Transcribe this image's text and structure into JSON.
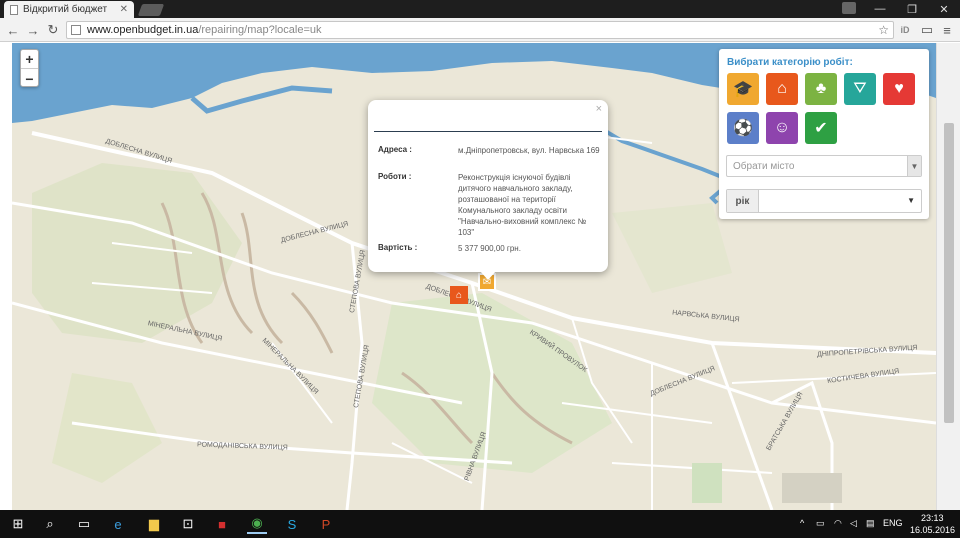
{
  "browser": {
    "tab_title": "Відкритий бюджет",
    "url_host": "www.openbudget.in.ua",
    "url_path": "/repairing/map?locale=uk"
  },
  "map": {
    "zoom_in": "+",
    "zoom_out": "−",
    "streets": [
      "ДОБЛЕСНА ВУЛИЦЯ",
      "ДОБЛЕСНА ВУЛИЦЯ",
      "ДОБЛЕСНА ВУЛИЦЯ",
      "ДОБЛЕСНА ВУЛИЦЯ",
      "МІНЕРАЛЬНА ВУЛИЦЯ",
      "МІНЕРАЛЬНА ВУЛИЦЯ",
      "СТЕПОВА ВУЛИЦЯ",
      "СТЕПОВА ВУЛИЦЯ",
      "РОМОДАНІВСЬКА ВУЛИЦЯ",
      "РІВНА ВУЛИЦЯ",
      "КРИВИЙ ПРОВУЛОК",
      "НАРВСЬКА ВУЛИЦЯ",
      "ДНІПРОПЕТРІВСЬКА ВУЛИЦЯ",
      "БРАТСЬКА ВУЛИЦЯ",
      "КОСТИЧЕВА ВУЛИЦЯ"
    ]
  },
  "popup": {
    "close": "×",
    "address_label": "Адреса :",
    "address_value": "м.Дніпропетровськ, вул. Нарвська 169",
    "works_label": "Роботи :",
    "works_value": "Реконструкція існуючої будівлі дитячого навчального закладу, розташованої на території Комунального закладу освіти \"Навчально-виховний комплекс № 103\"",
    "cost_label": "Вартість :",
    "cost_value": "5 377 900,00 грн."
  },
  "panel": {
    "title": "Вибрати категорію робіт:",
    "city_placeholder": "Обрати місто",
    "year_label": "рік",
    "categories": [
      {
        "icon": "education-cap-icon",
        "color": "#f0a830"
      },
      {
        "icon": "kindergarten-icon",
        "color": "#e8581c"
      },
      {
        "icon": "park-tree-icon",
        "color": "#7cb342"
      },
      {
        "icon": "road-icon",
        "color": "#26a69a"
      },
      {
        "icon": "heart-health-icon",
        "color": "#e53935"
      },
      {
        "icon": "sport-ball-icon",
        "color": "#5c7fc9"
      },
      {
        "icon": "culture-masks-icon",
        "color": "#8e44ad"
      },
      {
        "icon": "safety-check-icon",
        "color": "#2ea043"
      }
    ]
  },
  "taskbar": {
    "lang": "ENG",
    "time": "23:13",
    "date": "16.05.2016"
  }
}
